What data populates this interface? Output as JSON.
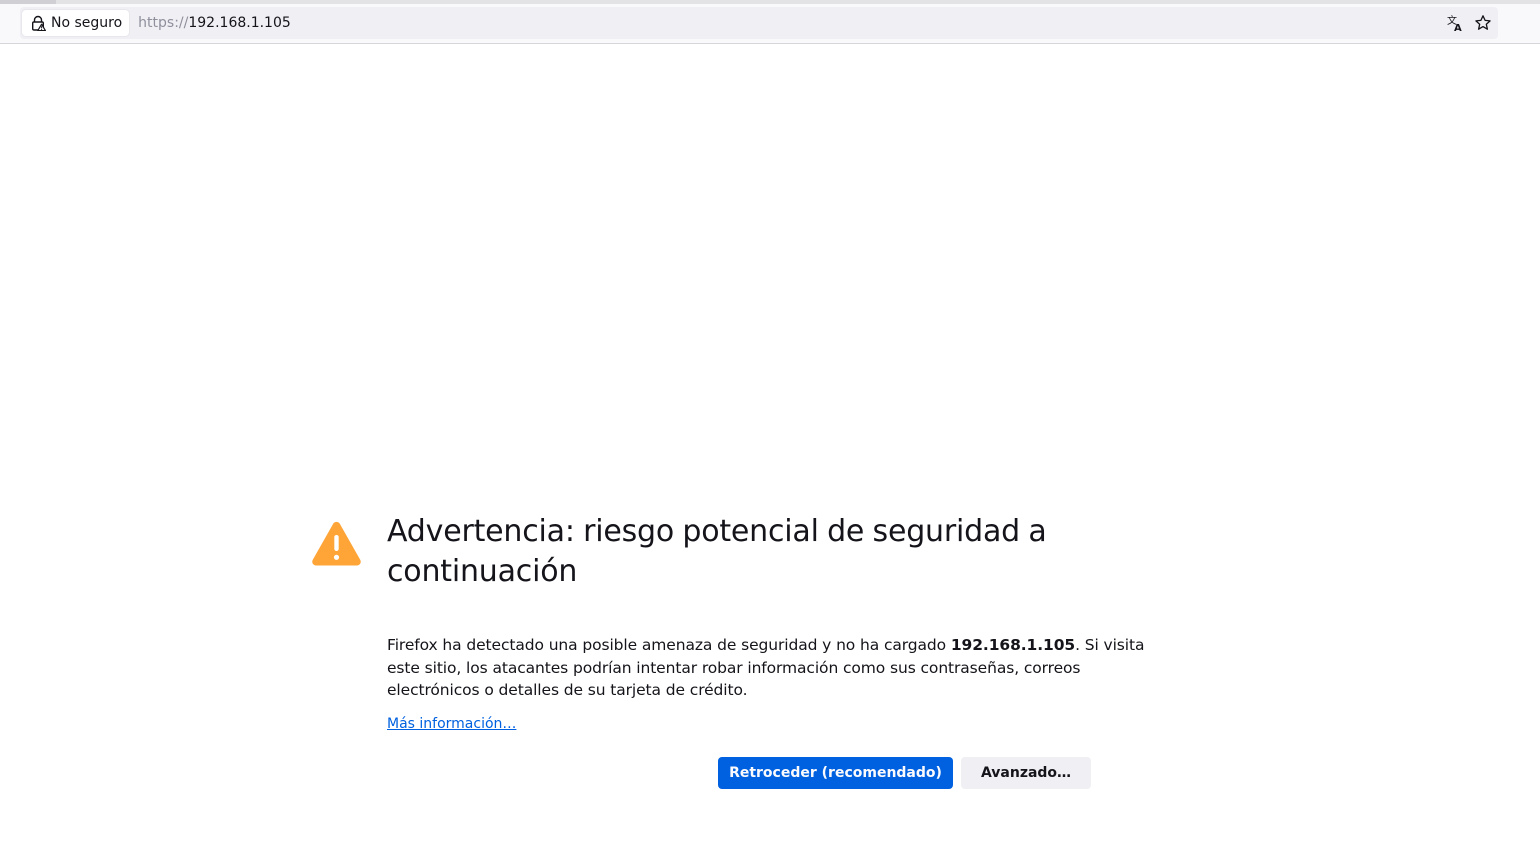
{
  "browser": {
    "identity_label": "No seguro",
    "url_scheme": "https://",
    "url_host": "192.168.1.105",
    "icons": {
      "identity": "insecure-lock-icon",
      "translate": "translate-icon",
      "bookmark": "star-icon"
    }
  },
  "error": {
    "icon": "warning-icon",
    "icon_color": "#ffa436",
    "title": "Advertencia: riesgo potencial de seguridad a continuación",
    "desc_before": "Firefox ha detectado una posible amenaza de seguridad y no ha cargado ",
    "desc_host": "192.168.1.105",
    "desc_after": ". Si visita este sitio, los atacantes podrían intentar robar información como sus contraseñas, correos electrónicos o detalles de su tarjeta de crédito.",
    "learn_more": "Más información…",
    "primary_button": "Retroceder (recomendado)",
    "secondary_button": "Avanzado…"
  },
  "colors": {
    "accent": "#0061e0",
    "warning": "#ffa436"
  }
}
